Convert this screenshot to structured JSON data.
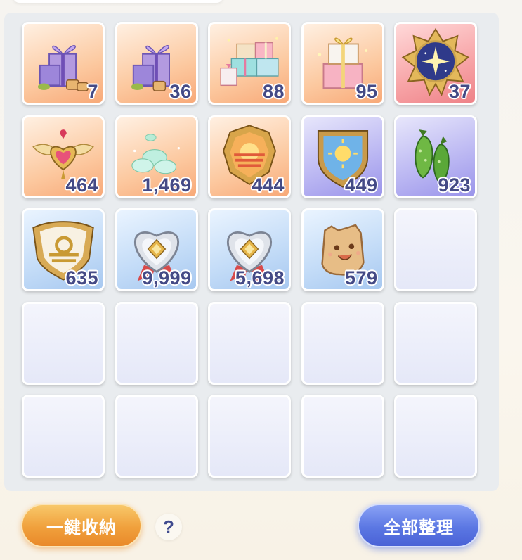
{
  "inventory": {
    "items": [
      {
        "count": "7",
        "icon": "purple-gift-box-icon",
        "bg": "orange"
      },
      {
        "count": "36",
        "icon": "purple-gift-box-icon",
        "bg": "orange"
      },
      {
        "count": "88",
        "icon": "gift-boxes-pile-icon",
        "bg": "orange"
      },
      {
        "count": "95",
        "icon": "pink-gift-stack-icon",
        "bg": "orange"
      },
      {
        "count": "37",
        "icon": "starry-emblem-icon",
        "bg": "pink"
      },
      {
        "count": "464",
        "icon": "winged-heart-icon",
        "bg": "orange"
      },
      {
        "count": "1,469",
        "icon": "mint-cloud-icon",
        "bg": "orange"
      },
      {
        "count": "444",
        "icon": "sunset-badge-icon",
        "bg": "orange"
      },
      {
        "count": "449",
        "icon": "sun-badge-icon",
        "bg": "purple"
      },
      {
        "count": "923",
        "icon": "cucumber-icon",
        "bg": "purple"
      },
      {
        "count": "635",
        "icon": "libra-shield-icon",
        "bg": "blue"
      },
      {
        "count": "9,999",
        "icon": "silver-heart-medal-icon",
        "bg": "blue"
      },
      {
        "count": "5,698",
        "icon": "silver-heart-medal-icon",
        "bg": "blue"
      },
      {
        "count": "579",
        "icon": "toast-cracker-icon",
        "bg": "blue"
      }
    ],
    "empty_slots": 11
  },
  "buttons": {
    "collect_all_label": "一鍵收納",
    "sort_all_label": "全部整理",
    "help_label": "?"
  }
}
